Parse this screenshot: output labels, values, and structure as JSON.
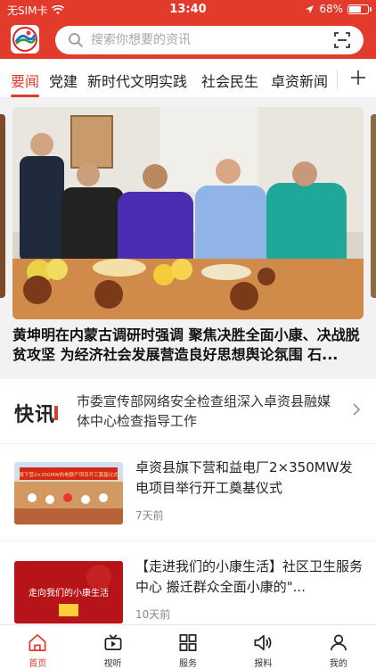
{
  "status_bar": {
    "carrier": "无SIM卡",
    "time": "13:40",
    "battery": "68%",
    "battery_level": 0.68
  },
  "search": {
    "placeholder": "搜索你想要的资讯"
  },
  "tabs": [
    {
      "label": "要闻",
      "active": true
    },
    {
      "label": "党建"
    },
    {
      "label": "新时代文明实践"
    },
    {
      "label": "社会民生"
    },
    {
      "label": "卓资新闻"
    }
  ],
  "banner": {
    "title": "黄坤明在内蒙古调研时强调 聚焦决胜全面小康、决战脱贫攻坚 为经济社会发展营造良好思想舆论氛围 石..."
  },
  "flash": {
    "logo_text": "快讯",
    "text": "市委宣传部网络安全检查组深入卓资县融媒体中心检查指导工作"
  },
  "news": [
    {
      "title": "卓资县旗下营和益电厂2×350MW发电项目举行开工奠基仪式",
      "time": "7天前",
      "thumb_banner": "旗下营2×350MW热电联产项目开工奠基仪式"
    },
    {
      "title": "【走进我们的小康生活】社区卫生服务中心 搬迁群众全面小康的\"...",
      "time": "10天前",
      "thumb_text": "走向我们的小康生活"
    }
  ],
  "bottom_nav": [
    {
      "label": "首页",
      "icon": "home-icon",
      "active": true
    },
    {
      "label": "视听",
      "icon": "video-icon"
    },
    {
      "label": "服务",
      "icon": "grid-icon"
    },
    {
      "label": "报料",
      "icon": "speaker-icon"
    },
    {
      "label": "我的",
      "icon": "user-icon"
    }
  ],
  "colors": {
    "brand_red": "#e23a2b"
  }
}
